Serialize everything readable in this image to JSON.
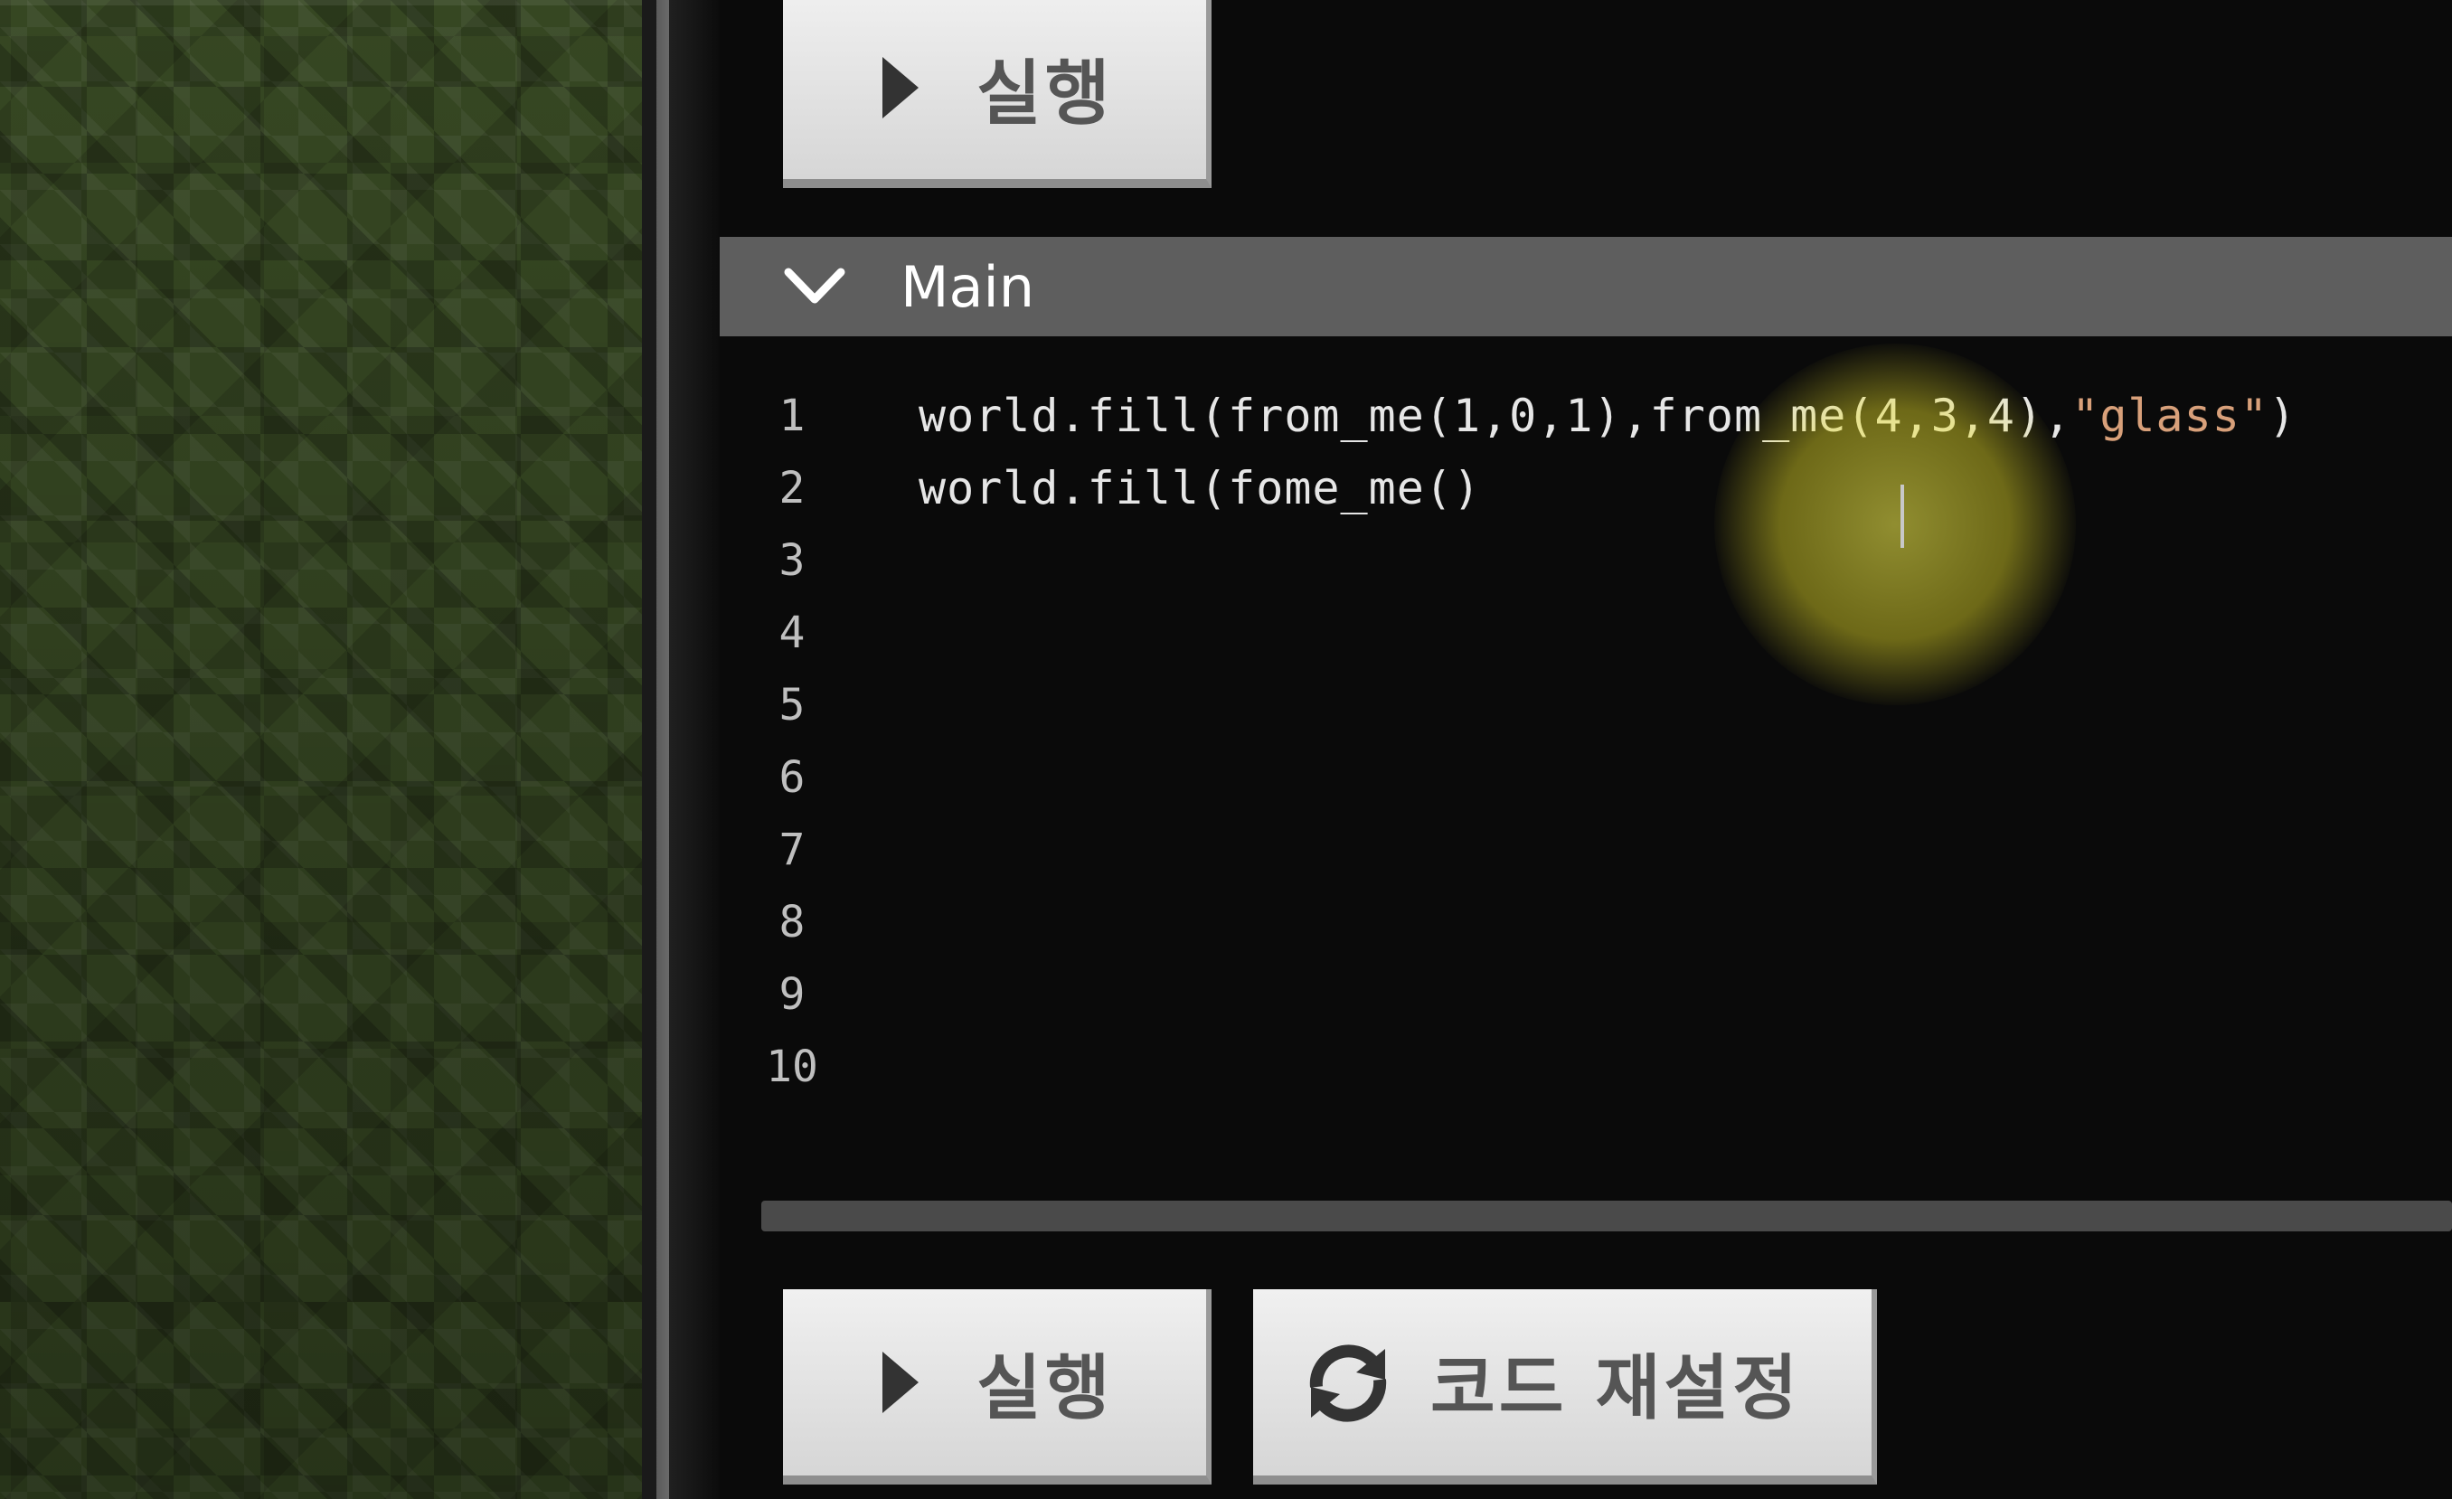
{
  "toolbar": {
    "run_label": "실행"
  },
  "section": {
    "title": "Main",
    "expanded": true
  },
  "editor": {
    "line_numbers": [
      "1",
      "2",
      "3",
      "4",
      "5",
      "6",
      "7",
      "8",
      "9",
      "10"
    ],
    "lines": [
      {
        "before": "world.fill(from_me(1,0,1),from_me(4,3,4),",
        "string": "\"glass\"",
        "after": ")"
      },
      {
        "code": "world.fill(fome_me()"
      }
    ]
  },
  "footer": {
    "run_label": "실행",
    "reset_label": "코드 재설정"
  },
  "icons": {
    "run": "play-icon",
    "reset": "refresh-icon",
    "section_toggle": "chevron-down-icon"
  },
  "colors": {
    "string_literal": "#d8a07a",
    "header_bg": "#5e5e5e",
    "button_bg": "#e4e4e4"
  }
}
